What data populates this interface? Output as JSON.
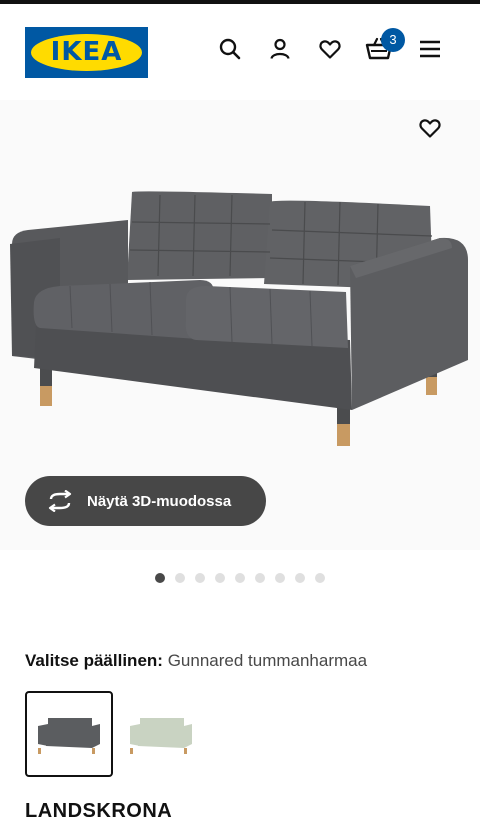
{
  "header": {
    "logo_text": "IKEA",
    "cart_count": "3",
    "icons": [
      "search-icon",
      "account-icon",
      "heart-icon",
      "basket-icon",
      "menu-icon"
    ]
  },
  "gallery": {
    "view3d_label": "Näytä 3D-muodossa",
    "image_count": 9,
    "active_index": 0
  },
  "cover": {
    "label": "Valitse päällinen:",
    "value": "Gunnared tummanharmaa",
    "options": [
      {
        "color": "#5b5d60",
        "selected": true
      },
      {
        "color": "#c9d3c2",
        "selected": false
      }
    ]
  },
  "product": {
    "name": "LANDSKRONA"
  },
  "colors": {
    "ikea_blue": "#0058a3",
    "ikea_yellow": "#ffdb00",
    "button_dark": "#474747"
  }
}
